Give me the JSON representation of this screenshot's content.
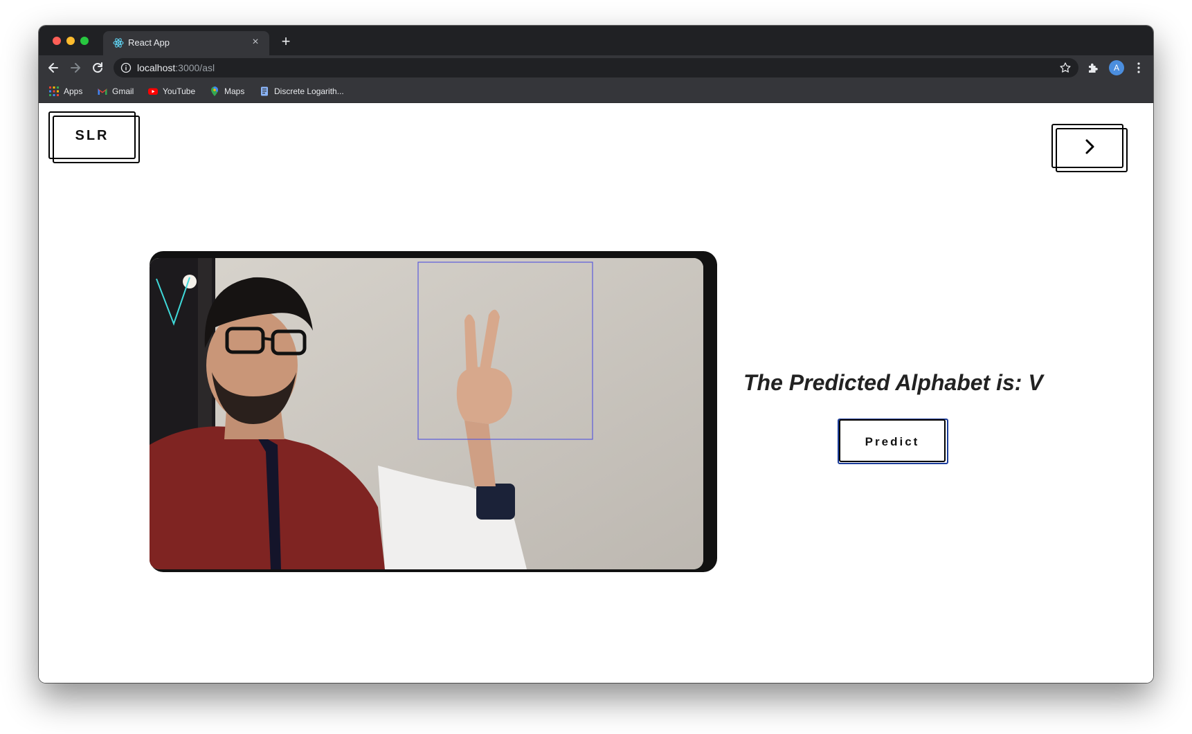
{
  "browser": {
    "tab_title": "React App",
    "tab_close": "×",
    "new_tab": "+",
    "url_host": "localhost",
    "url_path": ":3000/asl",
    "avatar_letter": "A",
    "bookmarks": [
      {
        "label": "Apps",
        "icon": "apps-grid-icon"
      },
      {
        "label": "Gmail",
        "icon": "gmail-icon"
      },
      {
        "label": "YouTube",
        "icon": "youtube-icon"
      },
      {
        "label": "Maps",
        "icon": "maps-icon"
      },
      {
        "label": "Discrete Logarith...",
        "icon": "bookmark-page-icon"
      }
    ]
  },
  "page": {
    "logo_text": "SLR",
    "next_button_icon": "chevron-right-icon",
    "detected_letter_overlay": "V",
    "prediction_text": "The Predicted Alphabet is: V",
    "predict_button_label": "Predict"
  },
  "colors": {
    "browser_frame": "#202124",
    "toolbar": "#35363a",
    "button_border": "#000000",
    "predict_accent": "#1a3b9a",
    "roi_box": "#5b5bdc",
    "overlay_letter": "#3fd9d9"
  }
}
